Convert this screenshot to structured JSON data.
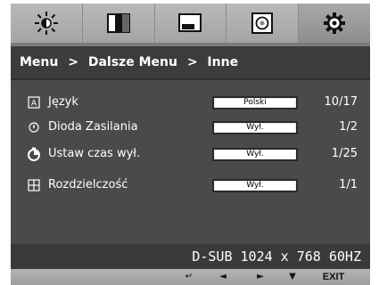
{
  "tabs": [
    {
      "name": "brightness",
      "icon": "brightness-icon"
    },
    {
      "name": "picture",
      "icon": "contrast-icon"
    },
    {
      "name": "display",
      "icon": "monitor-icon"
    },
    {
      "name": "color",
      "icon": "color-disc-icon"
    },
    {
      "name": "settings",
      "icon": "gear-icon",
      "active": true
    }
  ],
  "breadcrumb": {
    "part1": "Menu",
    "sep1": ">",
    "part2": "Dalsze Menu",
    "sep2": ">",
    "part3": "Inne"
  },
  "items": [
    {
      "icon": "language-icon",
      "label": "Język",
      "value": "Polski",
      "count": "10/17"
    },
    {
      "icon": "power-led-icon",
      "label": "Dioda Zasilania",
      "value": "Wył.",
      "count": "1/2"
    },
    {
      "icon": "timer-icon",
      "label": "Ustaw czas wył.",
      "value": "Wył.",
      "count": "1/25"
    },
    {
      "icon": "resolution-icon",
      "label": "Rozdzielczość",
      "value": "Wył.",
      "count": "1/1"
    }
  ],
  "status": "D-SUB 1024 x 768 60HZ",
  "nav": {
    "enter": "↵",
    "left": "◄",
    "right": "►",
    "down": "▼",
    "exit": "EXIT"
  },
  "colors": {
    "panel": "#4a4a4a",
    "crumb": "#3c3c3c",
    "tabbar": "#b0b0b0",
    "text": "#ffffff"
  }
}
